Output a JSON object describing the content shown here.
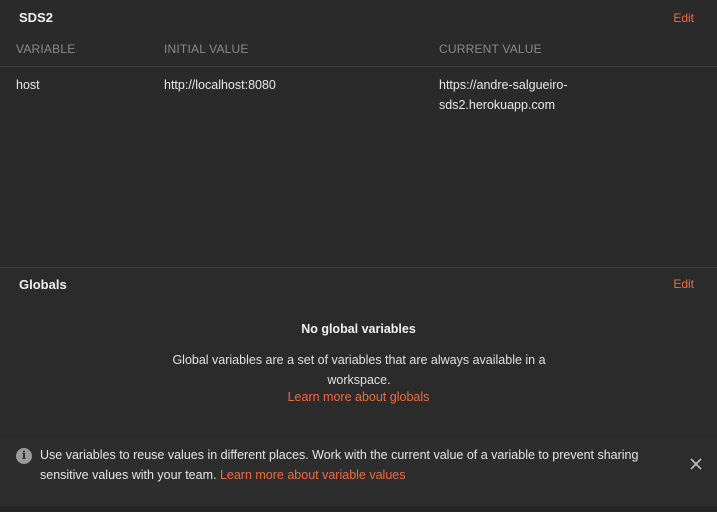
{
  "environment": {
    "name": "SDS2",
    "edit_label": "Edit",
    "columns": {
      "variable": "VARIABLE",
      "initial_value": "INITIAL VALUE",
      "current_value": "CURRENT VALUE"
    },
    "rows": [
      {
        "variable": "host",
        "initial_value": "http://localhost:8080",
        "current_value_line1": "https://andre-salgueiro-",
        "current_value_line2": "sds2.herokuapp.com"
      }
    ]
  },
  "globals": {
    "title": "Globals",
    "edit_label": "Edit",
    "empty_title": "No global variables",
    "empty_description": "Global variables are a set of variables that are always available in a workspace.",
    "learn_more": "Learn more about globals"
  },
  "info_banner": {
    "icon": "info-icon",
    "text": "Use variables to reuse values in different places. Work with the current value of a variable to prevent sharing sensitive values with your team. ",
    "link": "Learn more about variable values",
    "close_icon": "close-icon"
  },
  "colors": {
    "accent": "#f26b3a",
    "background": "#2b2b2b",
    "muted_text": "#8a8a8a"
  }
}
